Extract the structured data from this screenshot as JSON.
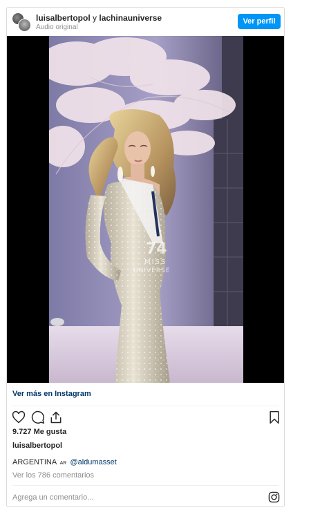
{
  "header": {
    "user1": "luisalbertopol",
    "connector": " y ",
    "user2": "lachinauniverse",
    "subtitle": "Audio original",
    "profile_button": "Ver perfil"
  },
  "media": {
    "watermark_number": "74",
    "watermark_line1": "MISS",
    "watermark_line2": "UNIVERSE"
  },
  "links": {
    "view_more": "Ver más en Instagram"
  },
  "post": {
    "likes": "9.727 Me gusta",
    "owner": "luisalbertopol",
    "caption_text": "ARGENTINA",
    "caption_flag": "AR",
    "caption_mention": "@aldumasset",
    "view_comments": "Ver los 786 comentarios",
    "comment_placeholder": "Agrega un comentario..."
  },
  "icons": {
    "like": "heart-icon",
    "comment": "comment-icon",
    "share": "share-icon",
    "save": "bookmark-icon",
    "instagram": "instagram-icon"
  },
  "colors": {
    "accent": "#0095f6",
    "link": "#00376b",
    "muted": "#8e8e8e"
  }
}
